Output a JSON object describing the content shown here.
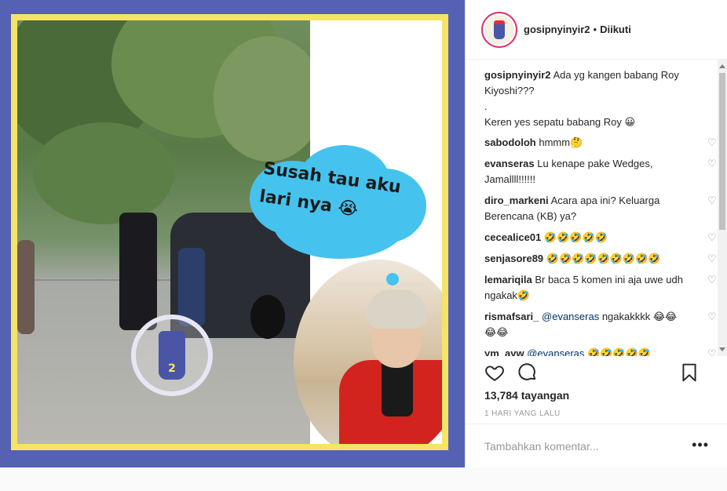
{
  "overlay": {
    "bubble_text": "Susah tau aku lari nya",
    "bubble_emoji": "😭"
  },
  "logo_number": "2",
  "header": {
    "username": "gosipnyinyir2",
    "separator": "•",
    "follow_status": "Diikuti"
  },
  "caption": {
    "username": "gosipnyinyir2",
    "line1": "Ada yg kangen babang Roy Kiyoshi???",
    "line2": ".",
    "line3": "Keren yes sepatu babang Roy 😀"
  },
  "comments": [
    {
      "user": "sabodoloh",
      "text": "hmmm🤔"
    },
    {
      "user": "evanseras",
      "text": "Lu kenape pake Wedges, Jamallll!!!!!!"
    },
    {
      "user": "diro_markeni",
      "text": "Acara apa ini? Keluarga Berencana (KB) ya?"
    },
    {
      "user": "cecealice01",
      "text": "🤣🤣🤣🤣🤣"
    },
    {
      "user": "senjasore89",
      "text": "🤣🤣🤣🤣🤣🤣🤣🤣🤣"
    },
    {
      "user": "lemariqila",
      "text": "Br baca 5 komen ini aja uwe udh ngakak🤣"
    },
    {
      "user": "rismafsari_",
      "mention": "@evanseras",
      "text": "ngakakkkk 😂😂😂😂"
    },
    {
      "user": "ym_avw",
      "mention": "@evanseras",
      "text": "🤣🤣🤣🤣🤣"
    }
  ],
  "stats": {
    "views": "13,784 tayangan",
    "time_ago": "1 HARI YANG LALU"
  },
  "add_comment": {
    "placeholder": "Tambahkan komentar...",
    "more_label": "•••"
  },
  "icons": {
    "like": "heart-icon",
    "comment": "comment-icon",
    "save": "bookmark-icon",
    "comment_like": "small-heart-icon"
  },
  "colors": {
    "frame_blue": "#5561b3",
    "frame_yellow": "#f5e466",
    "bubble": "#45c3ee",
    "mention": "#003569"
  }
}
